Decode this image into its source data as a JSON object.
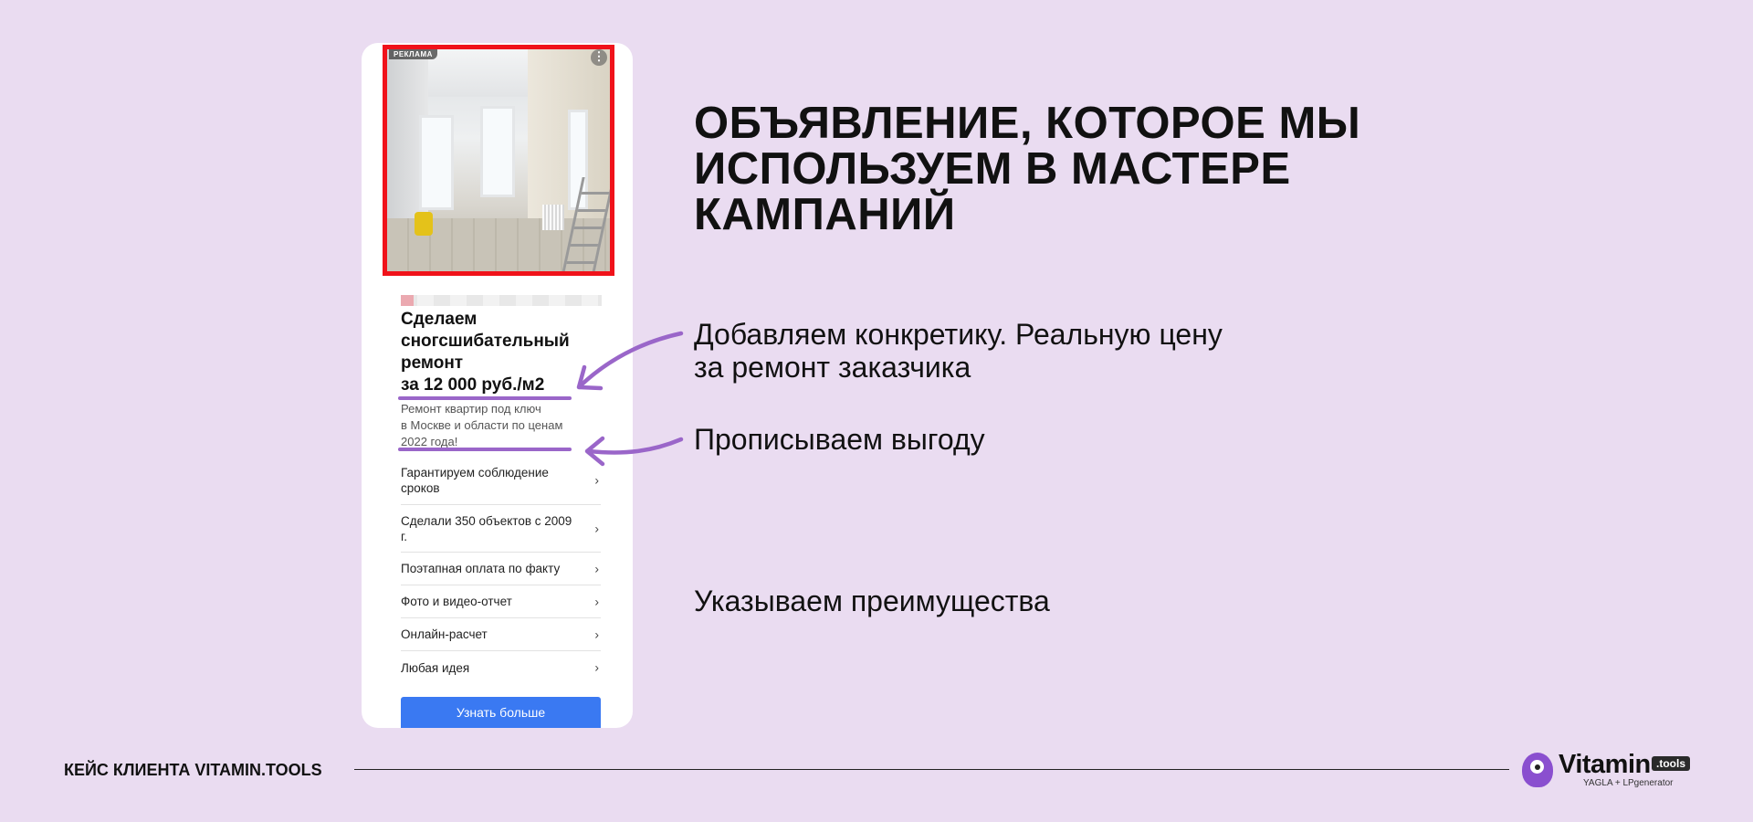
{
  "ad": {
    "badge": "РЕКЛАМА",
    "menu_glyph": "⋮",
    "title_lines": [
      "Сделаем",
      "сногсшибательный",
      "ремонт",
      "за 12 000 руб./м2"
    ],
    "description_lines": [
      "Ремонт квартир под ключ",
      "в Москве и области по ценам",
      "2022 года!"
    ],
    "sitelinks": [
      {
        "label": "Гарантируем соблюдение сроков"
      },
      {
        "label": "Сделали 350 объектов с 2009 г."
      },
      {
        "label": "Поэтапная оплата по факту"
      },
      {
        "label": "Фото и видео-отчет"
      },
      {
        "label": "Онлайн-расчет"
      },
      {
        "label": "Любая идея"
      }
    ],
    "chevron": "›",
    "cta_label": "Узнать больше"
  },
  "headline_lines": [
    "ОБЪЯВЛЕНИЕ, КОТОРОЕ МЫ",
    "ИСПОЛЬЗУЕМ В МАСТЕРЕ",
    "КАМПАНИЙ"
  ],
  "notes": {
    "concrete_lines": [
      "Добавляем конкретику. Реальную цену",
      "за ремонт заказчика"
    ],
    "benefit": "Прописываем выгоду",
    "advantages": "Указываем преимущества"
  },
  "footer": {
    "label": "КЕЙС КЛИЕНТА VITAMIN.TOOLS",
    "logo_name": "Vitamin",
    "logo_tld": ".tools",
    "logo_sub": "YAGLA + LPgenerator"
  },
  "colors": {
    "background": "#eadcf1",
    "accent_purple": "#9a66c9",
    "image_border": "#f0121a",
    "cta_blue": "#3a79f2"
  }
}
